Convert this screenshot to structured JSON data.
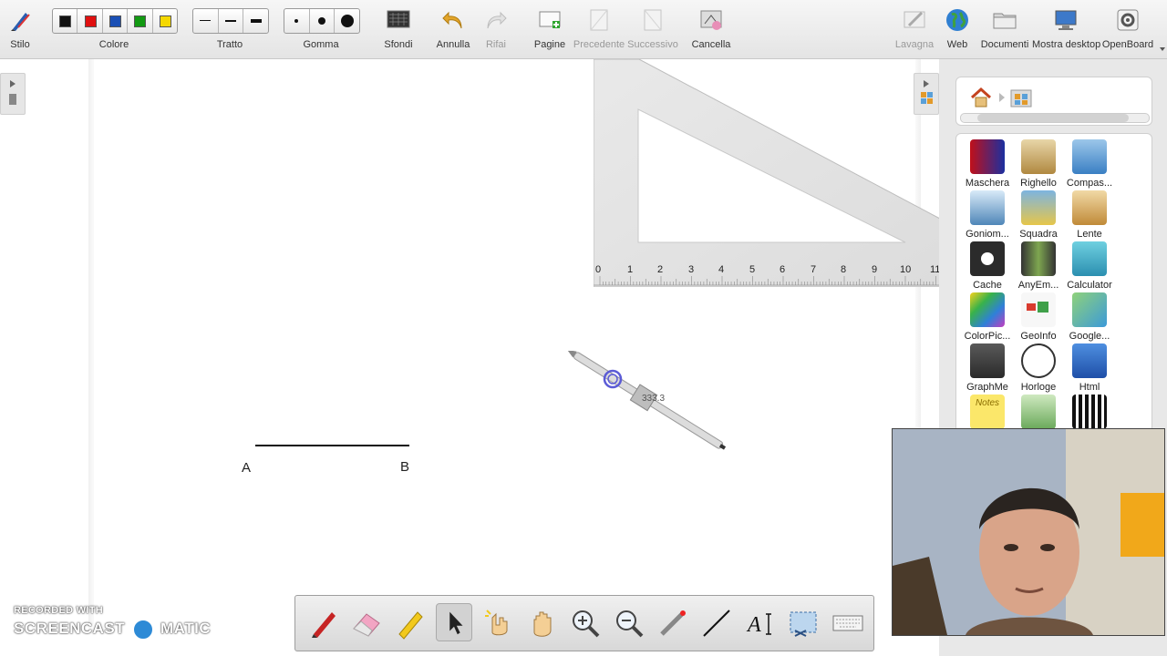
{
  "toolbar": {
    "stilo": "Stilo",
    "colore": "Colore",
    "tratto": "Tratto",
    "gomma": "Gomma",
    "sfondi": "Sfondi",
    "annulla": "Annulla",
    "rifai": "Rifai",
    "pagine": "Pagine",
    "precedente": "Precedente",
    "successivo": "Successivo",
    "cancella": "Cancella",
    "lavagna": "Lavagna",
    "web": "Web",
    "documenti": "Documenti",
    "mostra_desktop": "Mostra desktop",
    "openboard": "OpenBoard"
  },
  "colors": {
    "black": "#111111",
    "red": "#e01010",
    "blue": "#1a4fb5",
    "green": "#129a12",
    "yellow": "#f5d800"
  },
  "canvas": {
    "point_a": "A",
    "point_b": "B",
    "ruler_ticks": [
      "0",
      "1",
      "2",
      "3",
      "4",
      "5",
      "6",
      "7",
      "8",
      "9",
      "10",
      "11"
    ],
    "compass_readout": "333.3"
  },
  "library": {
    "apps": [
      {
        "name": "Maschera"
      },
      {
        "name": "Righello"
      },
      {
        "name": "Compas..."
      },
      {
        "name": "Goniom..."
      },
      {
        "name": "Squadra"
      },
      {
        "name": "Lente"
      },
      {
        "name": "Cache"
      },
      {
        "name": "AnyEm..."
      },
      {
        "name": "Calculator"
      },
      {
        "name": "ColorPic..."
      },
      {
        "name": "GeoInfo"
      },
      {
        "name": "Google..."
      },
      {
        "name": "GraphMe"
      },
      {
        "name": "Horloge"
      },
      {
        "name": "Html"
      },
      {
        "name": "Notes"
      },
      {
        "name": ""
      },
      {
        "name": ""
      }
    ]
  },
  "bottom_tools": [
    "pen-tool",
    "eraser-tool",
    "highlighter-tool",
    "selector-tool",
    "interact-tool",
    "hand-tool",
    "zoom-in-tool",
    "zoom-out-tool",
    "laser-pointer-tool",
    "line-tool",
    "text-tool",
    "capture-tool",
    "keyboard-tool"
  ],
  "watermark": {
    "line1": "RECORDED WITH",
    "line2a": "SCREENCAST",
    "line2b": "MATIC"
  }
}
